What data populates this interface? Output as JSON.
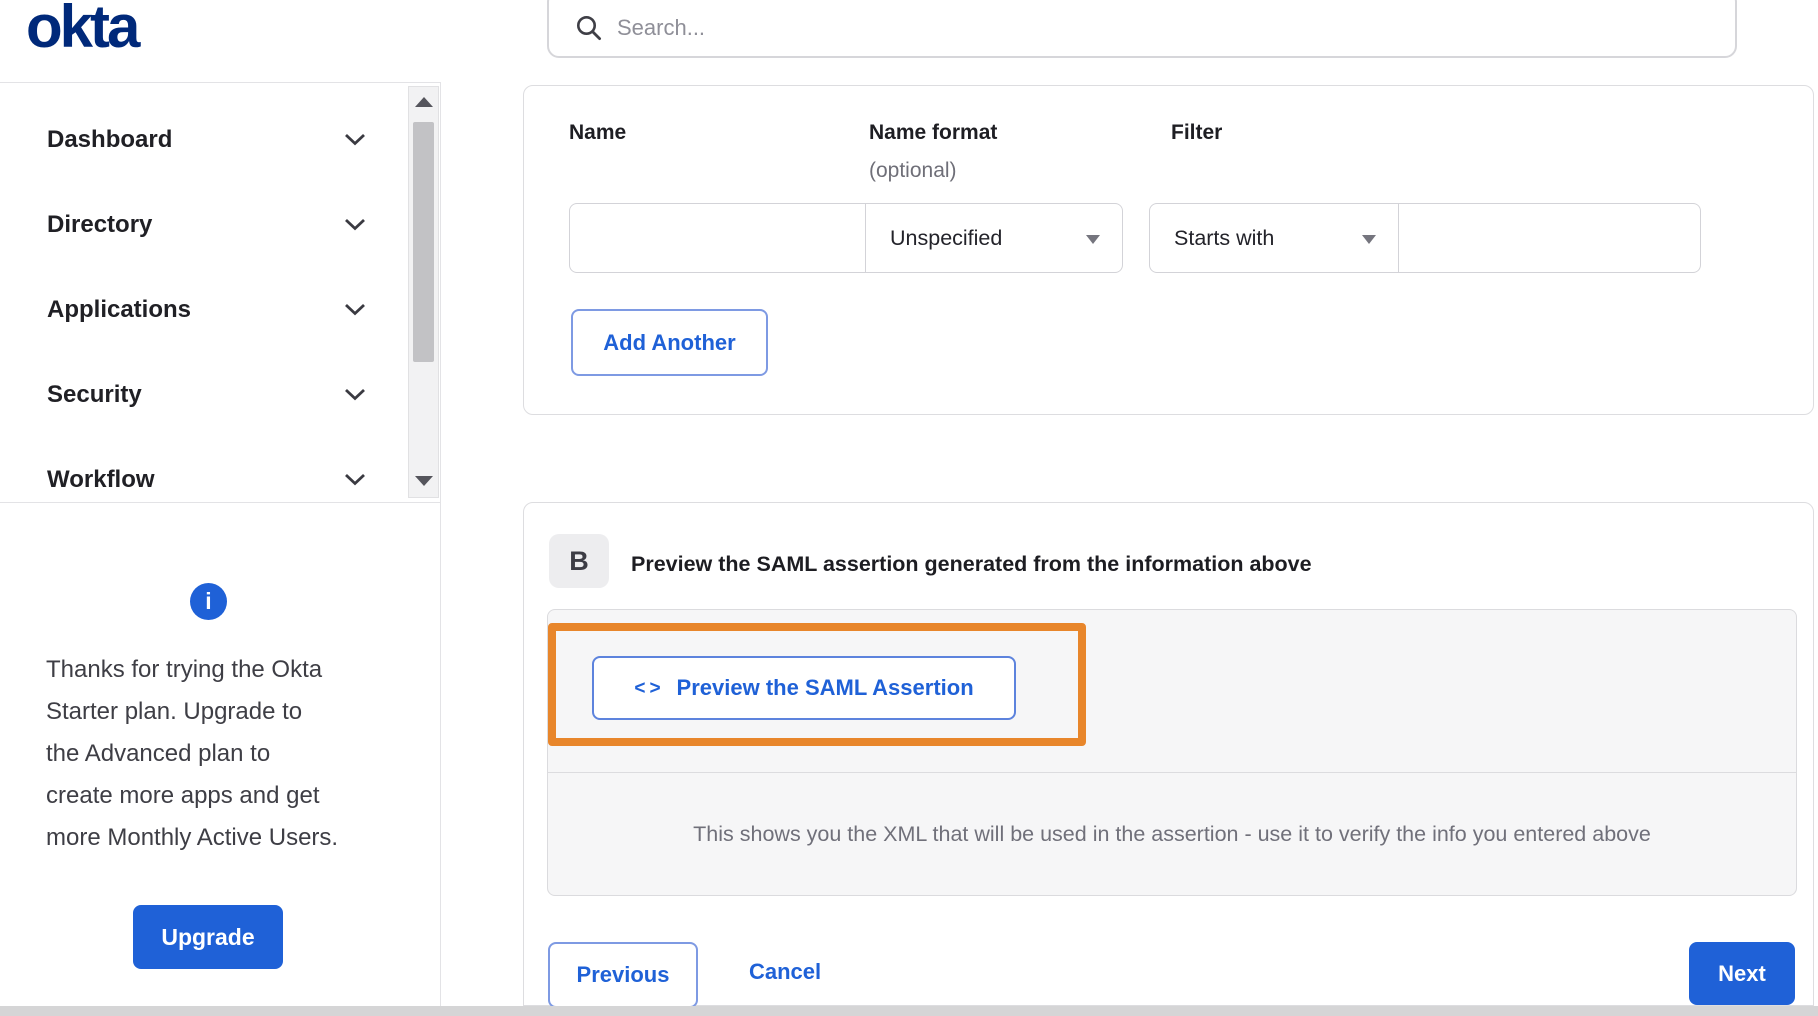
{
  "brand": {
    "logo_text": "okta",
    "logo_color": "#00297a"
  },
  "header": {
    "search": {
      "placeholder": "Search...",
      "value": ""
    }
  },
  "sidebar": {
    "items": [
      {
        "label": "Dashboard"
      },
      {
        "label": "Directory"
      },
      {
        "label": "Applications"
      },
      {
        "label": "Security"
      },
      {
        "label": "Workflow"
      }
    ]
  },
  "upgrade_panel": {
    "info_icon_glyph": "i",
    "message_lines": [
      "Thanks for trying the Okta",
      "Starter plan. Upgrade to",
      "the Advanced plan to",
      "create more apps and get",
      "more Monthly Active Users."
    ],
    "button_label": "Upgrade"
  },
  "attribute_form": {
    "name_label": "Name",
    "name_format_label": "Name format",
    "name_format_note": "(optional)",
    "filter_label": "Filter",
    "name_value": "",
    "name_format_value": "Unspecified",
    "filter_type_value": "Starts with",
    "filter_text_value": "",
    "add_another_label": "Add Another"
  },
  "preview_section": {
    "step_label": "B",
    "title": "Preview the SAML assertion generated from the information above",
    "code_icon_glyph": "<>",
    "preview_button_label": "Preview the SAML Assertion",
    "description": "This shows you the XML that will be used in the assertion - use it to verify the info you entered above"
  },
  "wizard_footer": {
    "previous_label": "Previous",
    "cancel_label": "Cancel",
    "next_label": "Next"
  },
  "colors": {
    "primary_blue": "#1f61d7",
    "logo_navy": "#00297a",
    "highlight_orange": "#e8862b"
  }
}
